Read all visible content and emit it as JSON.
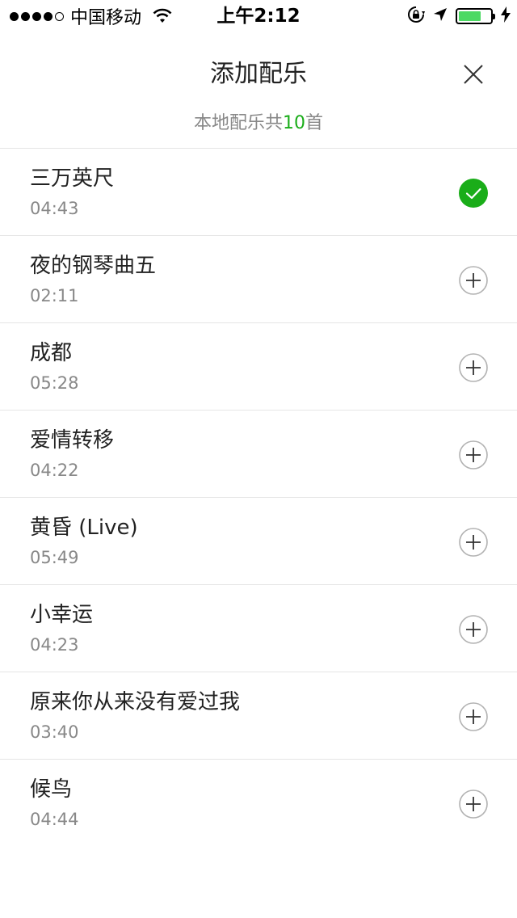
{
  "status_bar": {
    "carrier": "中国移动",
    "time": "上午2:12",
    "signal_bars_filled": 4,
    "signal_bars_total": 5,
    "battery_level_percent": 70,
    "battery_color": "#4cd964"
  },
  "header": {
    "title": "添加配乐",
    "close_icon": "close-icon"
  },
  "subtitle": {
    "prefix": "本地配乐共",
    "count": "10",
    "suffix": "首"
  },
  "colors": {
    "accent_green": "#1aad19",
    "check_green": "#1aad19",
    "divider": "#e5e5e5"
  },
  "songs": [
    {
      "name": "三万英尺",
      "duration": "04:43",
      "selected": true
    },
    {
      "name": "夜的钢琴曲五",
      "duration": "02:11",
      "selected": false
    },
    {
      "name": "成都",
      "duration": "05:28",
      "selected": false
    },
    {
      "name": "爱情转移",
      "duration": "04:22",
      "selected": false
    },
    {
      "name": "黄昏 (Live)",
      "duration": "05:49",
      "selected": false
    },
    {
      "name": "小幸运",
      "duration": "04:23",
      "selected": false
    },
    {
      "name": "原来你从来没有爱过我",
      "duration": "03:40",
      "selected": false
    },
    {
      "name": "候鸟",
      "duration": "04:44",
      "selected": false
    }
  ]
}
